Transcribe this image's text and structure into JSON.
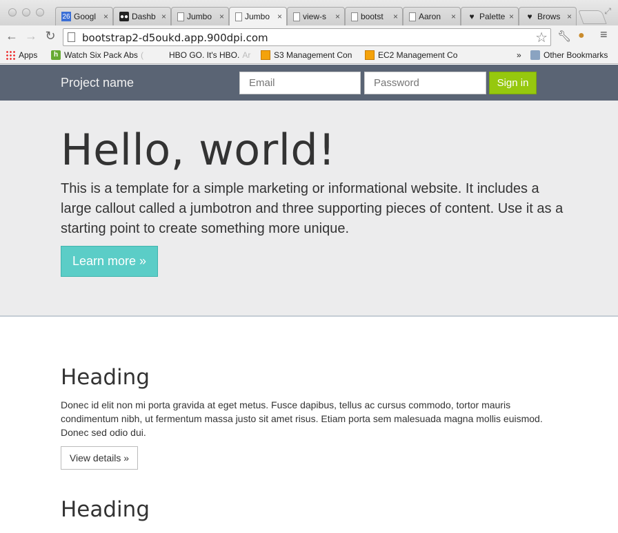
{
  "browser": {
    "tabs": [
      {
        "title": "Googl",
        "icon": "calendar-icon",
        "icon_text": "26"
      },
      {
        "title": "Dashb",
        "icon": "robot-icon"
      },
      {
        "title": "Jumbo",
        "icon": "page-icon"
      },
      {
        "title": "Jumbo",
        "icon": "page-icon",
        "active": true
      },
      {
        "title": "view-s",
        "icon": "page-icon"
      },
      {
        "title": "bootst",
        "icon": "page-icon"
      },
      {
        "title": "Aaron",
        "icon": "page-icon"
      },
      {
        "title": "Palette",
        "icon": "heart-icon"
      },
      {
        "title": "Brows",
        "icon": "heart-icon"
      }
    ],
    "tab_close": "×",
    "url": "bootstrap2-d5oukd.app.900dpi.com",
    "bookmarks": [
      {
        "label": "Apps",
        "icon": "apps-grid-icon"
      },
      {
        "label": "Watch Six Pack Abs",
        "faded": "(",
        "icon": "hulu-icon",
        "icon_text": "h"
      },
      {
        "label": "HBO GO. It's HBO.",
        "faded": "Ar",
        "icon": ""
      },
      {
        "label": "S3 Management Con",
        "icon": "aws-box-icon"
      },
      {
        "label": "EC2 Management Co",
        "icon": "aws-box-icon"
      }
    ],
    "bookmarks_overflow": "»",
    "other_bookmarks": "Other Bookmarks"
  },
  "navbar": {
    "brand": "Project name",
    "email_placeholder": "Email",
    "password_placeholder": "Password",
    "signin_label": "Sign in"
  },
  "jumbotron": {
    "title": "Hello, world!",
    "lead": "This is a template for a simple marketing or informational website. It includes a large callout called a jumbotron and three supporting pieces of content. Use it as a starting point to create something more unique.",
    "button": "Learn more »"
  },
  "sections": [
    {
      "heading": "Heading",
      "body": "Donec id elit non mi porta gravida at eget metus. Fusce dapibus, tellus ac cursus commodo, tortor mauris condimentum nibh, ut fermentum massa justo sit amet risus. Etiam porta sem malesuada magna mollis euismod. Donec sed odio dui.",
      "button": "View details »"
    },
    {
      "heading": "Heading"
    }
  ],
  "colors": {
    "navbar_bg": "#5a6474",
    "signin_bg": "#96c80e",
    "learn_more_bg": "#5bcdc7",
    "jumbotron_bg": "#ececed"
  }
}
